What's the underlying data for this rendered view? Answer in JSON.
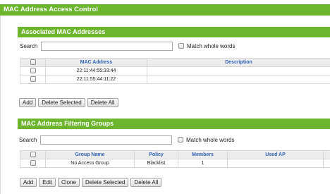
{
  "window": {
    "title": "MAC Address Access Control"
  },
  "associated": {
    "title": "Associated MAC Addresses",
    "search_label": "Search",
    "search_value": "",
    "match_label": "Match whole words",
    "columns": [
      "",
      "MAC Address",
      "Description"
    ],
    "rows": [
      {
        "mac": "22:11:44:55:33:44",
        "description": ""
      },
      {
        "mac": "22:11:55:44:11:22",
        "description": ""
      }
    ],
    "buttons": {
      "add": "Add",
      "delete_selected": "Delete Selected",
      "delete_all": "Delete All"
    }
  },
  "groups": {
    "title": "MAC Address Filtering Groups",
    "search_label": "Search",
    "search_value": "",
    "match_label": "Match whole words",
    "columns": [
      "",
      "Group Name",
      "Policy",
      "Members",
      "Used AP",
      ""
    ],
    "rows": [
      {
        "name": "No Access Group",
        "policy": "Blacklist",
        "members": "1",
        "used_ap": ""
      }
    ],
    "buttons": {
      "add": "Add",
      "edit": "Edit",
      "clone": "Clone",
      "delete_selected": "Delete Selected",
      "delete_all": "Delete All"
    }
  },
  "colors": {
    "header_green": "#6cb52d",
    "column_header_blue": "#2f63b5"
  }
}
